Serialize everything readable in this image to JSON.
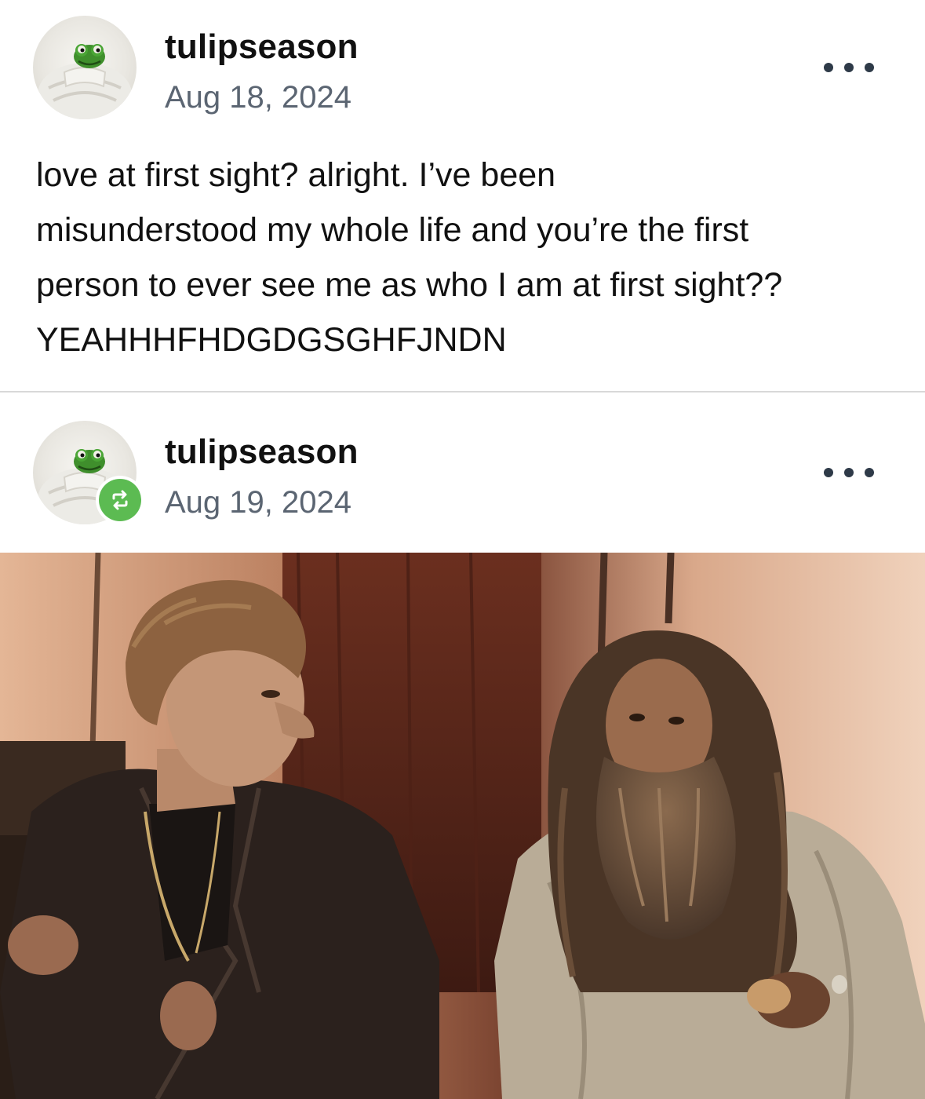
{
  "posts": [
    {
      "username": "tulipseason",
      "date": "Aug 18, 2024",
      "body_lines": [
        "love at first sight? alright. I’ve been",
        "misunderstood my whole life and you’re the first",
        "person to ever see me as who I am at first sight??",
        "YEAHHHFHDGDGSGHFJNDN"
      ],
      "more_icon": "ellipsis-icon"
    },
    {
      "username": "tulipseason",
      "date": "Aug 19, 2024",
      "reblog_icon": "reblog-icon",
      "reblog_color": "#5cbb52",
      "more_icon": "ellipsis-icon"
    }
  ],
  "colors": {
    "username": "#111111",
    "date": "#5b6572",
    "divider": "#d8d8d8",
    "dots": "#2e3a48"
  }
}
